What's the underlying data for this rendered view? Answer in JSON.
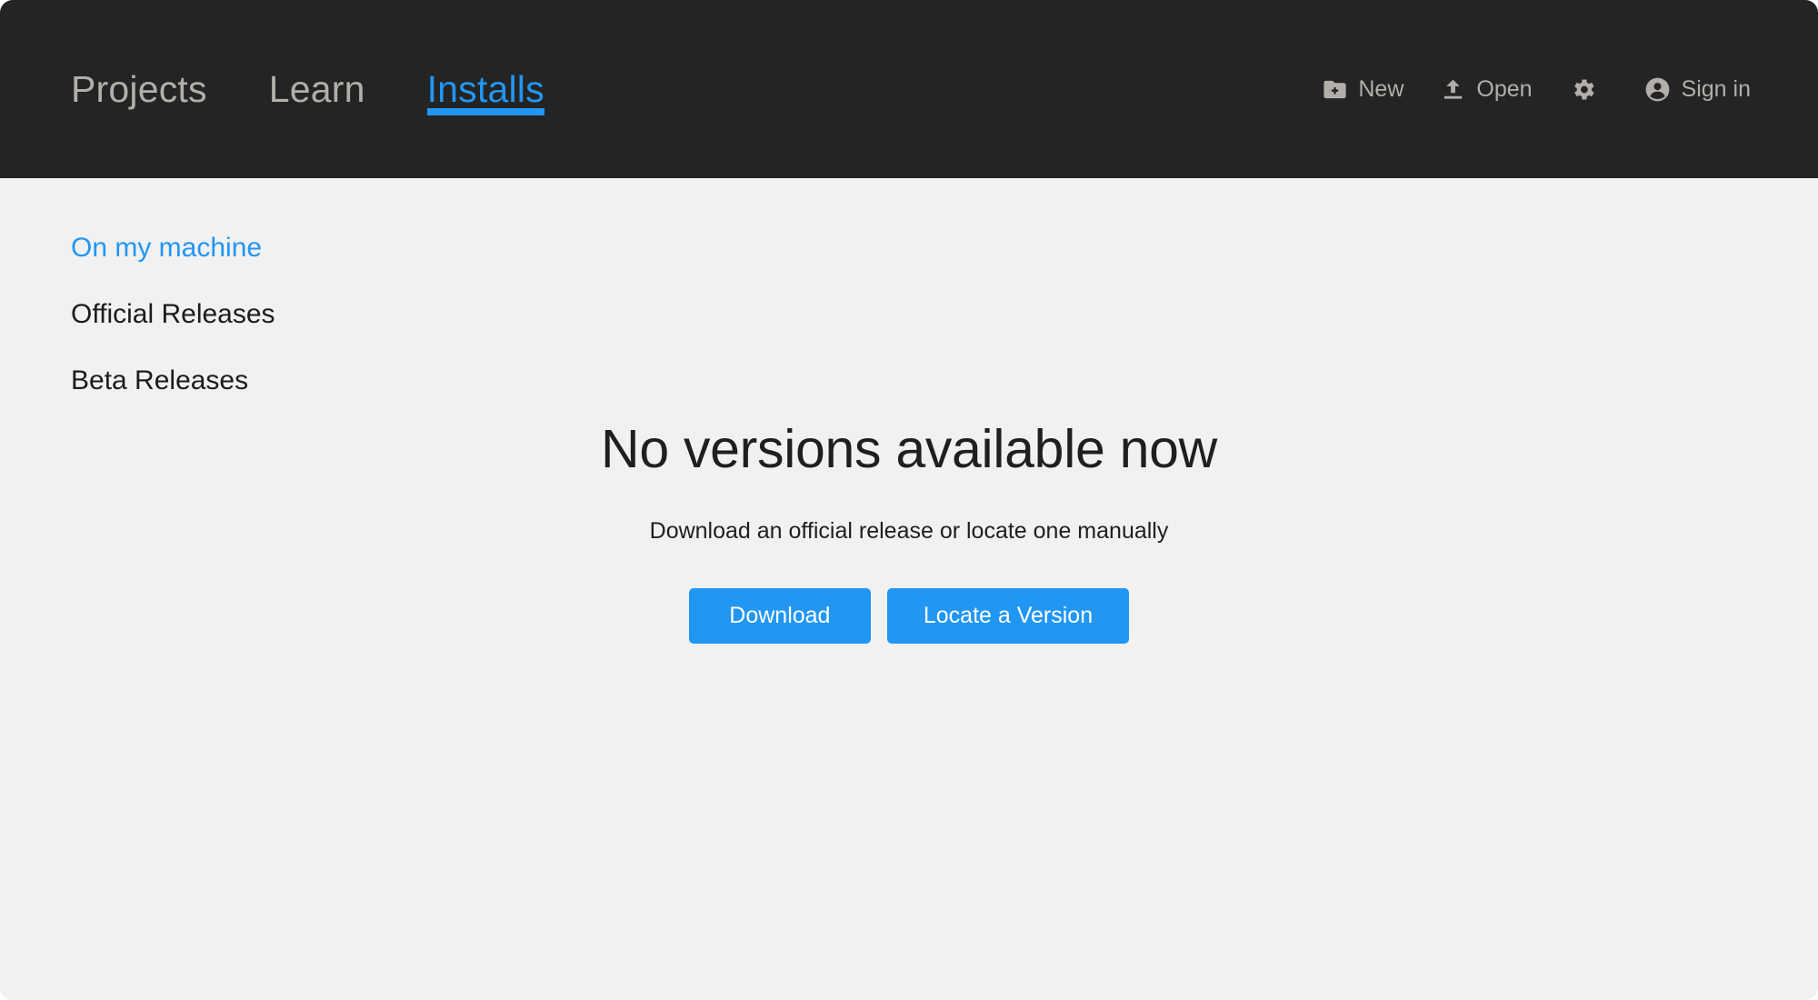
{
  "window": {
    "background": "#f1f1f1",
    "header_background": "#242424",
    "accent_color": "#2196f3",
    "muted_text_color": "#b2aeaa"
  },
  "header": {
    "tabs": [
      {
        "label": "Projects",
        "active": false,
        "icon": ""
      },
      {
        "label": "Learn",
        "active": false,
        "icon": ""
      },
      {
        "label": "Installs",
        "active": true,
        "icon": ""
      }
    ],
    "actions": [
      {
        "label": "New",
        "icon": "folder-plus-icon"
      },
      {
        "label": "Open",
        "icon": "upload-icon"
      },
      {
        "label": "",
        "icon": "gear-icon"
      },
      {
        "label": "Sign in",
        "icon": "account-circle-icon"
      }
    ]
  },
  "sidebar": {
    "items": [
      {
        "label": "On my machine",
        "active": true
      },
      {
        "label": "Official Releases",
        "active": false
      },
      {
        "label": "Beta Releases",
        "active": false
      }
    ]
  },
  "main": {
    "empty_state": {
      "title": "No versions available now",
      "subtitle": "Download an official release or locate one manually",
      "buttons": [
        {
          "label": "Download"
        },
        {
          "label": "Locate a Version"
        }
      ]
    }
  }
}
